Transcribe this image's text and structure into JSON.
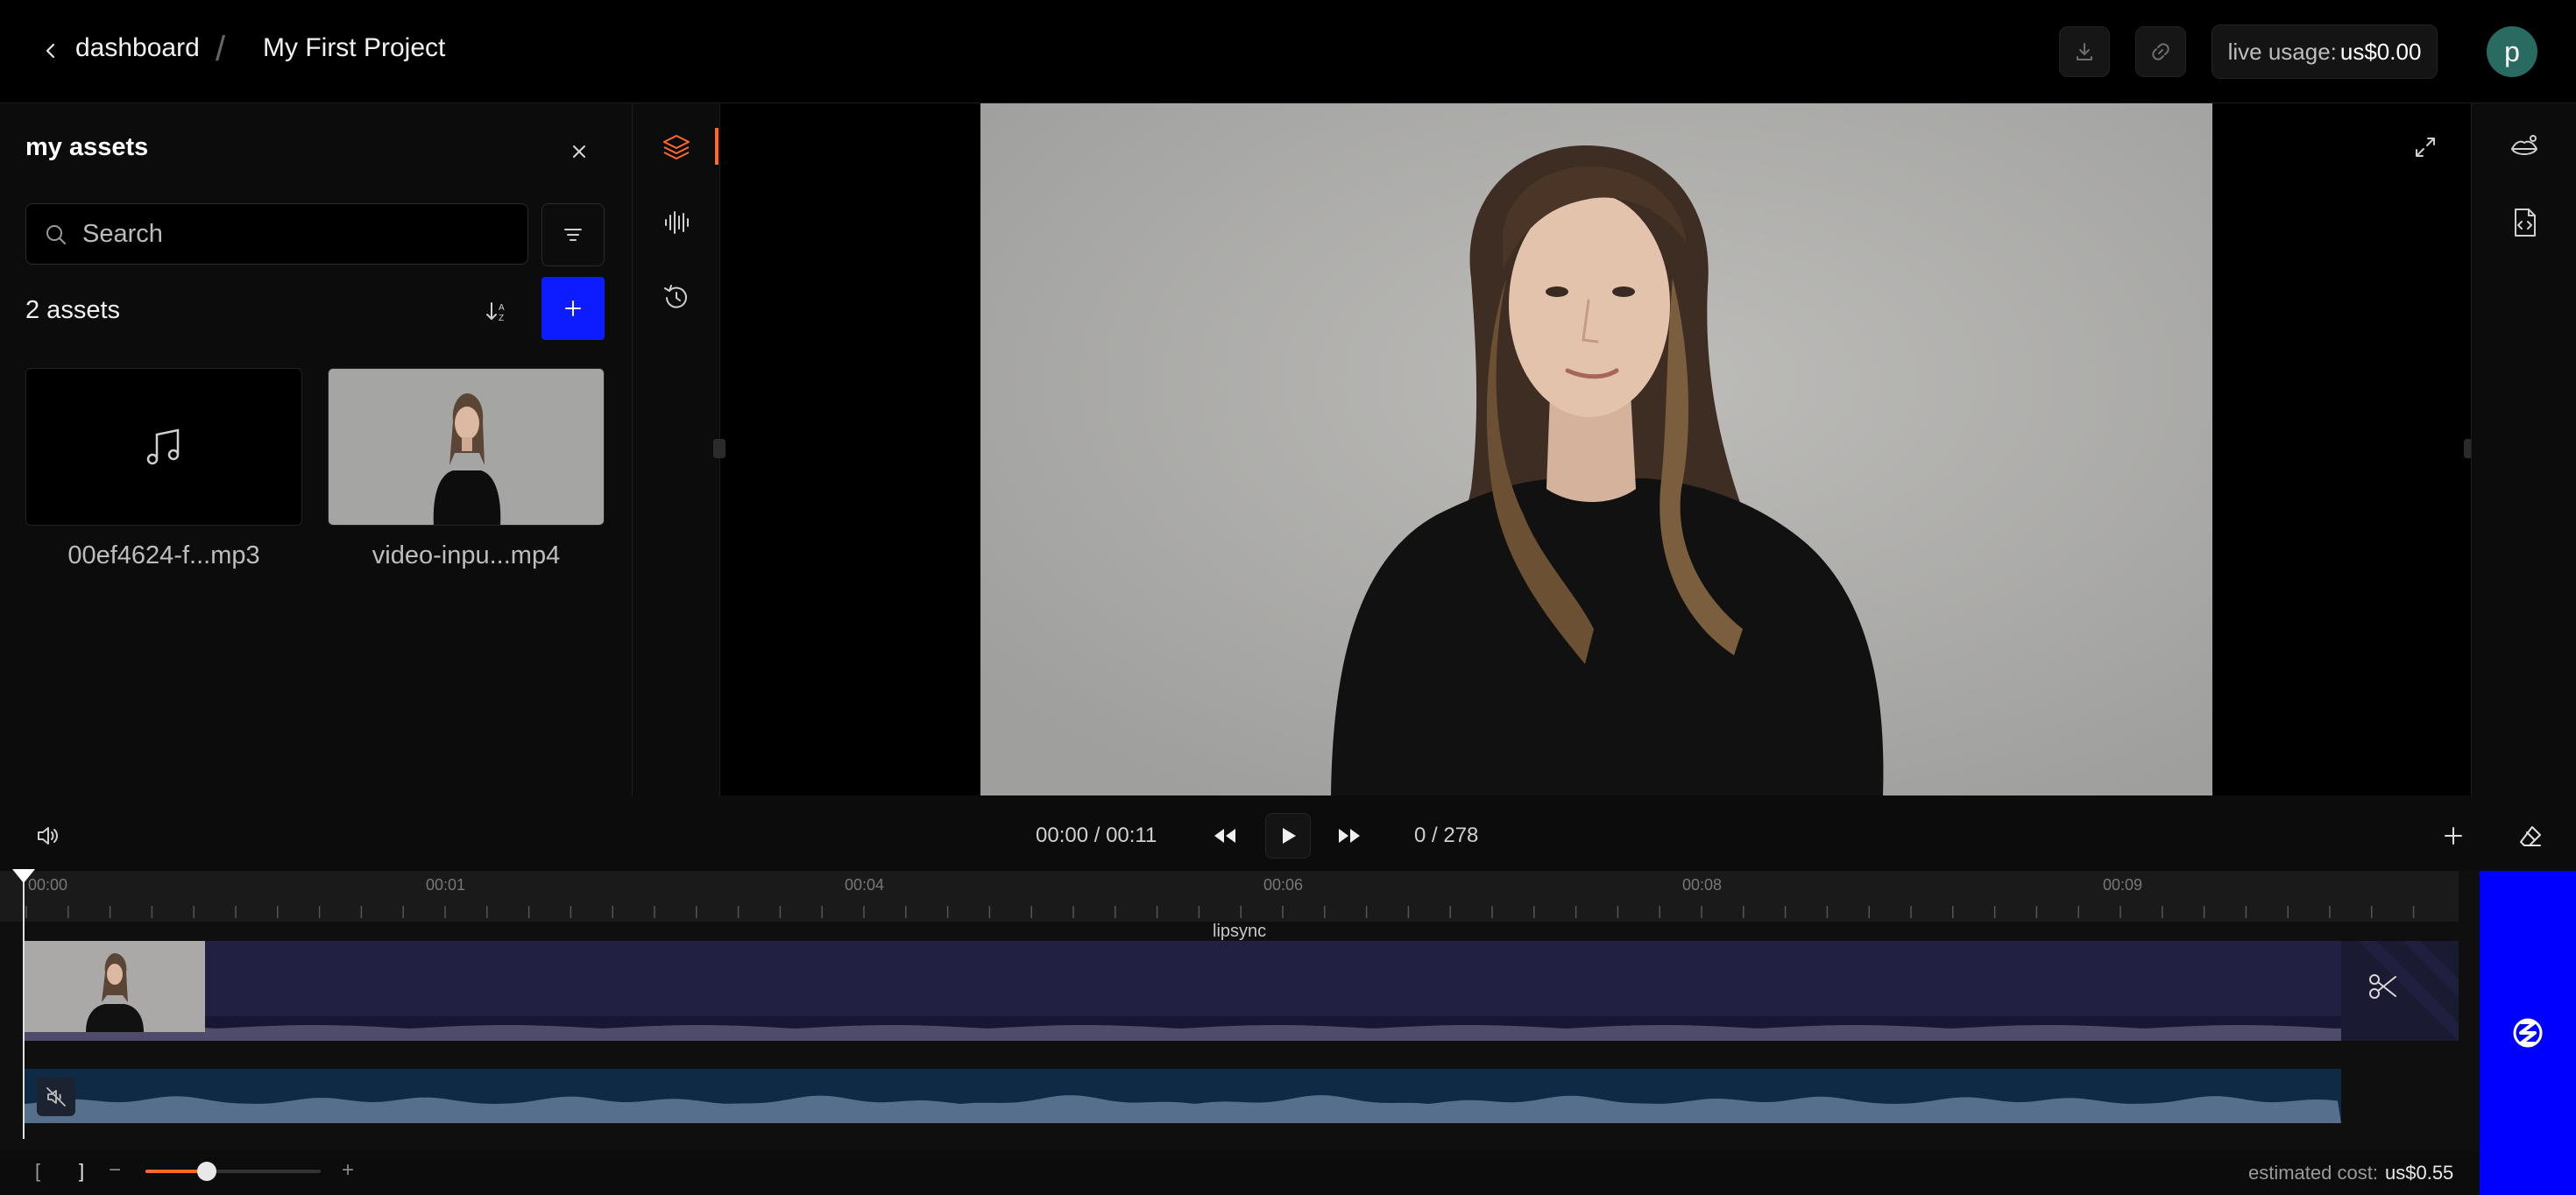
{
  "header": {
    "back_label": "dashboard",
    "separator": "/",
    "project_name": "My First Project",
    "usage_label": "live usage:",
    "usage_value": "us$0.00",
    "avatar_initial": "p"
  },
  "assets_panel": {
    "title": "my assets",
    "search_placeholder": "Search",
    "count_label": "2 assets",
    "items": [
      {
        "name": "00ef4624-f...mp3",
        "type": "audio"
      },
      {
        "name": "video-inpu...mp4",
        "type": "video"
      }
    ]
  },
  "player": {
    "time": "00:00 / 00:11",
    "frame": "0 / 278"
  },
  "timeline": {
    "ruler_labels": [
      "00:00",
      "00:01",
      "00:04",
      "00:06",
      "00:08",
      "00:09"
    ],
    "track_title": "lipsync"
  },
  "footer": {
    "bracket_open": "[",
    "bracket_close": "]",
    "zoom_minus": "−",
    "zoom_plus": "+",
    "zoom_level": 0.35,
    "cost_label": "estimated cost:",
    "cost_value": "us$0.55"
  },
  "colors": {
    "accent": "#ff6a2b",
    "primary": "#0d1bff",
    "render_bar": "#0000ff",
    "avatar": "#2a6b61",
    "video_track": "#211f42",
    "audio_track": "#0f2a44"
  }
}
